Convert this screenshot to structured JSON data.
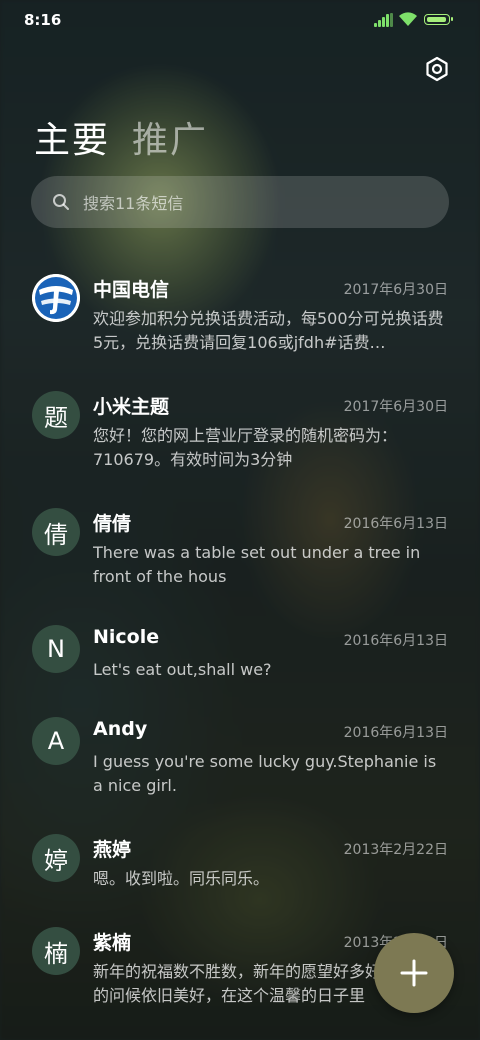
{
  "status_bar": {
    "time": "8:16"
  },
  "tabs": [
    {
      "label": "主要",
      "active": true
    },
    {
      "label": "推广",
      "active": false
    }
  ],
  "search": {
    "placeholder": "搜索11条短信"
  },
  "conversations": [
    {
      "avatar": "",
      "avatar_icon": "china-telecom-logo-icon",
      "name": "中国电信",
      "date": "2017年6月30日",
      "preview": "欢迎参加积分兑换话费活动，每500分可兑换话费5元，兑换话费请回复106或jfdh#话费…"
    },
    {
      "avatar": "题",
      "name": "小米主题",
      "date": "2017年6月30日",
      "preview": "您好！您的网上营业厅登录的随机密码为：710679。有效时间为3分钟"
    },
    {
      "avatar": "倩",
      "name": "倩倩",
      "date": "2016年6月13日",
      "preview": "There was a table set out under a tree in front of the hous"
    },
    {
      "avatar": "N",
      "name": "Nicole",
      "date": "2016年6月13日",
      "preview": "Let's eat out,shall we?"
    },
    {
      "avatar": "A",
      "name": "Andy",
      "date": "2016年6月13日",
      "preview": "I guess you're some lucky guy.Stephanie is a nice girl."
    },
    {
      "avatar": "婷",
      "name": "燕婷",
      "date": "2013年2月22日",
      "preview": "嗯。收到啦。同乐同乐。"
    },
    {
      "avatar": "楠",
      "name": "紫楠",
      "date": "2013年2月22日",
      "preview": "新年的祝福数不胜数，新年的愿望好多好多，新年的问候依旧美好，在这个温馨的日子里"
    }
  ],
  "colors": {
    "avatar_bg": "#344e41",
    "fab_bg": "#7d7953",
    "battery": "#a6ef7b",
    "signal": "#7ee06a"
  },
  "icons": {
    "settings": "settings-hexagon-icon",
    "search": "search-icon",
    "compose": "plus-icon"
  }
}
